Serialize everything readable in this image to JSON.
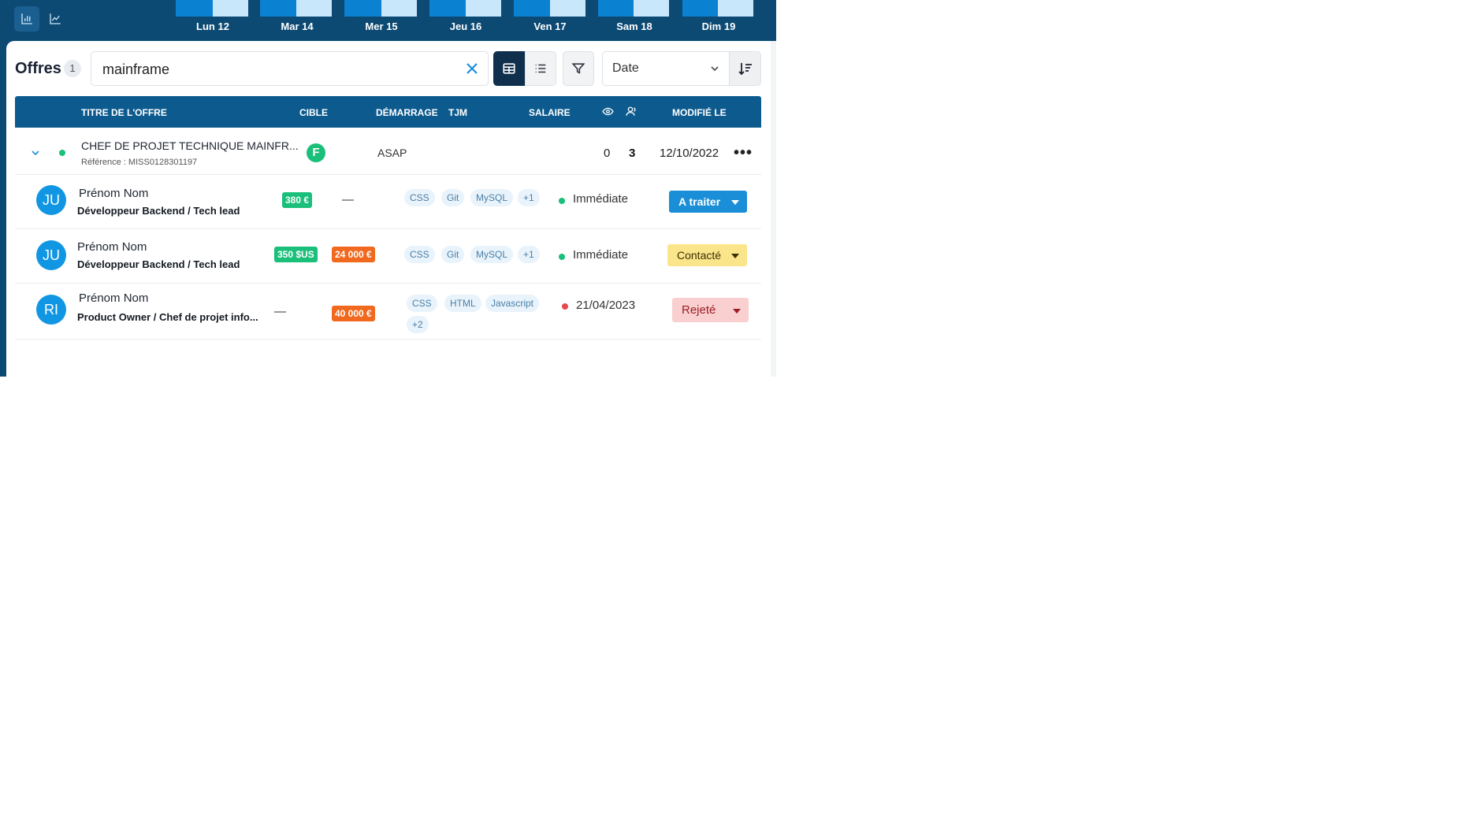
{
  "chart": {
    "days": [
      "Lun 12",
      "Mar 14",
      "Mer 15",
      "Jeu 16",
      "Ven 17",
      "Sam 18",
      "Dim 19"
    ]
  },
  "offres": {
    "title": "Offres",
    "count": "1"
  },
  "search": {
    "value": "mainframe",
    "placeholder": ""
  },
  "sort": {
    "selected": "Date"
  },
  "columns": {
    "titre": "TITRE DE L'OFFRE",
    "cible": "CIBLE",
    "demarrage": "DÉMARRAGE",
    "tjm": "TJM",
    "salaire": "SALAIRE",
    "modifie": "MODIFIÉ LE"
  },
  "offer": {
    "title": "CHEF DE PROJET TECHNIQUE MAINFR...",
    "reference": "Référence : MISS0128301197",
    "target": "F",
    "start": "ASAP",
    "views": "0",
    "candidates": "3",
    "modified": "12/10/2022"
  },
  "candidates": [
    {
      "initials": "JU",
      "name": "Prénom Nom",
      "job": "Développeur Backend / Tech lead",
      "tjm": "380 €",
      "salary": "—",
      "tags": [
        "CSS",
        "Git",
        "MySQL",
        "+1"
      ],
      "availability": "Immédiate",
      "status": "A traiter"
    },
    {
      "initials": "JU",
      "name": "Prénom Nom",
      "job": "Développeur Backend / Tech lead",
      "tjm": "350 $US",
      "salary": "24 000 €",
      "tags": [
        "CSS",
        "Git",
        "MySQL",
        "+1"
      ],
      "availability": "Immédiate",
      "status": "Contacté"
    },
    {
      "initials": "RI",
      "name": "Prénom Nom",
      "job": "Product Owner / Chef de projet info...",
      "tjm": "—",
      "salary": "40 000 €",
      "tags": [
        "CSS",
        "HTML",
        "Javascript",
        "+2"
      ],
      "availability": "21/04/2023",
      "status": "Rejeté"
    }
  ],
  "colors": {
    "header_bg": "#0c4a73",
    "table_head": "#0d5b8e",
    "accent": "#1a8fd8",
    "available": "#1abf7a",
    "unavailable": "#e5484d",
    "status_todo": "#1a8fd8",
    "status_contacted": "#fbe58b",
    "status_rejected": "#f9cfd0"
  }
}
